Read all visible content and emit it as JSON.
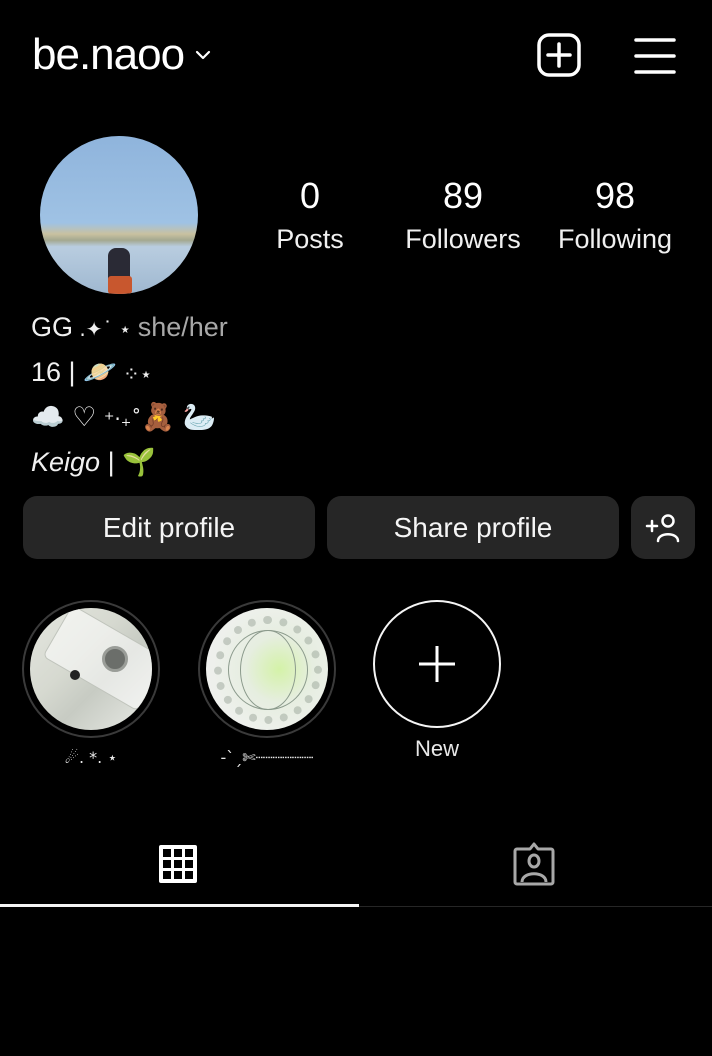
{
  "header": {
    "username": "be.naoo",
    "username_chevron_icon": "chevron-down-icon",
    "new_post_icon": "plus-square-icon",
    "menu_icon": "hamburger-menu-icon"
  },
  "profile": {
    "avatar_alt": "profile photo — person standing in water under blue sky",
    "stats": [
      {
        "value": "0",
        "label": "Posts"
      },
      {
        "value": "89",
        "label": "Followers"
      },
      {
        "value": "98",
        "label": "Following"
      }
    ]
  },
  "bio": {
    "name": "GG",
    "name_deco": " .✦˙ ⋆ ",
    "pronouns": "she/her",
    "line2_text": "16 | ",
    "line2_emoji": "🪐",
    "line2_deco": " ⁘⋆",
    "line3_cloud": "☁️",
    "line3_heart": " ♡ ",
    "line3_deco": "⁺‧₊˚",
    "line3_bear": "🧸",
    "line3_swan": "🦢",
    "line4_text": "Keigo",
    "line4_sep": " | ",
    "line4_emoji": "🌱"
  },
  "actions": {
    "edit_profile": "Edit profile",
    "share_profile": "Share profile",
    "discover_people_icon": "add-person-icon"
  },
  "highlights": [
    {
      "label": "☄︎. *. ⋆",
      "cover": "cassette tape photo"
    },
    {
      "label": "-ˋˏ✄┈┈┈┈┈┈",
      "cover": "globe logo photo"
    }
  ],
  "new_highlight": {
    "label": "New",
    "icon": "plus-icon"
  },
  "tabs": [
    {
      "name": "posts-grid",
      "icon": "grid-icon",
      "active": true
    },
    {
      "name": "tagged",
      "icon": "tagged-person-icon",
      "active": false
    }
  ]
}
